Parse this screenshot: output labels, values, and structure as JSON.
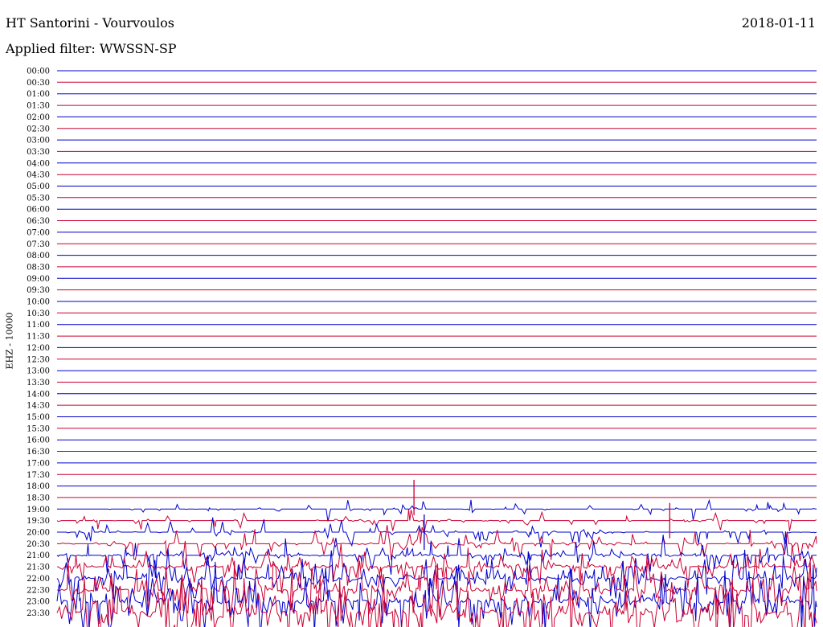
{
  "header": {
    "station": "HT Santorini - Vourvoulos",
    "filter": "Applied filter: WWSSN-SP",
    "date": "2018-01-11"
  },
  "chart_data": {
    "type": "line",
    "title": "HT Santorini - Vourvoulos",
    "subtitle": "Applied filter: WWSSN-SP",
    "ylabel": "EHZ - 10000",
    "xlabel": "",
    "trace_labels": [
      "00:00",
      "00:30",
      "01:00",
      "01:30",
      "02:00",
      "02:30",
      "03:00",
      "03:30",
      "04:00",
      "04:30",
      "05:00",
      "05:30",
      "06:00",
      "06:30",
      "07:00",
      "07:30",
      "08:00",
      "08:30",
      "09:00",
      "09:30",
      "10:00",
      "10:30",
      "11:00",
      "11:30",
      "12:00",
      "12:30",
      "13:00",
      "13:30",
      "14:00",
      "14:30",
      "15:00",
      "15:30",
      "16:00",
      "16:30",
      "17:00",
      "17:30",
      "18:00",
      "18:30",
      "19:00",
      "19:30",
      "20:00",
      "20:30",
      "21:00",
      "21:30",
      "22:00",
      "22:30",
      "23:00",
      "23:30"
    ],
    "trace_colors": [
      "#0000cc",
      "#cc0033"
    ],
    "line_minutes": 30,
    "quiet_until": "18:30",
    "activity_increasing_from": "20:00",
    "notable_events": [
      {
        "trace": "18:30",
        "minute_offset": 14.1
      },
      {
        "trace": "19:30",
        "minute_offset": 24.2
      },
      {
        "trace": "20:00",
        "minute_offset": 14.5
      }
    ],
    "grid": false,
    "legend": "none"
  }
}
